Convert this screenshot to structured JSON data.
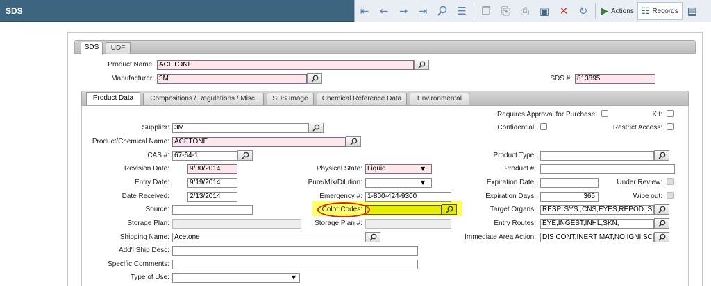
{
  "app": {
    "title": "SDS"
  },
  "toolbar": {
    "actions_label": "Actions",
    "records_label": "Records"
  },
  "top_tabs": [
    "SDS",
    "UDF"
  ],
  "header": {
    "product_name_label": "Product Name:",
    "product_name": "ACETONE",
    "manufacturer_label": "Manufacturer:",
    "manufacturer": "3M",
    "sds_no_label": "SDS #:",
    "sds_no": "813895"
  },
  "sub_tabs": [
    "Product Data",
    "Compositions / Regulations / Misc.",
    "SDS Image",
    "Chemical Reference Data",
    "Environmental"
  ],
  "left": {
    "supplier_label": "Supplier:",
    "supplier": "3M",
    "chem_name_label": "Product/Chemical Name:",
    "chem_name": "ACETONE",
    "cas_label": "CAS #:",
    "cas": "67-64-1",
    "revision_label": "Revision Date:",
    "revision": "9/30/2014",
    "entry_label": "Entry Date:",
    "entry": "9/19/2014",
    "received_label": "Date Received:",
    "received": "2/13/2014",
    "source_label": "Source:",
    "source": "",
    "storage_plan_label": "Storage Plan:",
    "storage_plan": "",
    "shipping_label": "Shipping Name:",
    "shipping": "Acetone",
    "addl_ship_label": "Add'l Ship Desc:",
    "addl_ship": "",
    "comments_label": "Specific Comments:",
    "comments": "",
    "type_of_use_label": "Type of Use:",
    "type_of_use": ""
  },
  "middle": {
    "physical_label": "Physical State:",
    "physical": "Liquid",
    "pure_label": "Pure/Mix/Dilution:",
    "pure": "",
    "emergency_label": "Emergency #:",
    "emergency": "1-800-424-9300",
    "color_label": "Color Codes:",
    "color": "",
    "storage_plan_no_label": "Storage Plan #:",
    "storage_plan_no": ""
  },
  "right": {
    "requires_approval_label": "Requires Approval for Purchase:",
    "kit_label": "Kit:",
    "confidential_label": "Confidential:",
    "restrict_label": "Restrict Access:",
    "product_type_label": "Product Type:",
    "product_type": "",
    "product_no_label": "Product #:",
    "product_no": "",
    "expiration_date_label": "Expiration Date:",
    "expiration_date": "",
    "under_review_label": "Under Review:",
    "expiration_days_label": "Expiration Days:",
    "expiration_days": "365",
    "wipe_out_label": "Wipe out:",
    "target_organs_label": "Target Organs:",
    "target_organs": "RESP. SYS.,CNS,EYES,REPOD. SYS,S",
    "entry_routes_label": "Entry Routes:",
    "entry_routes": "EYE,INGEST,INHL,SKN,",
    "immediate_label": "Immediate Area Action:",
    "immediate": "DIS CONT,INERT MAT,NO IGNI,SCB"
  },
  "icons": {
    "dropdown": "▼",
    "lookup": "magnifier-icon"
  }
}
